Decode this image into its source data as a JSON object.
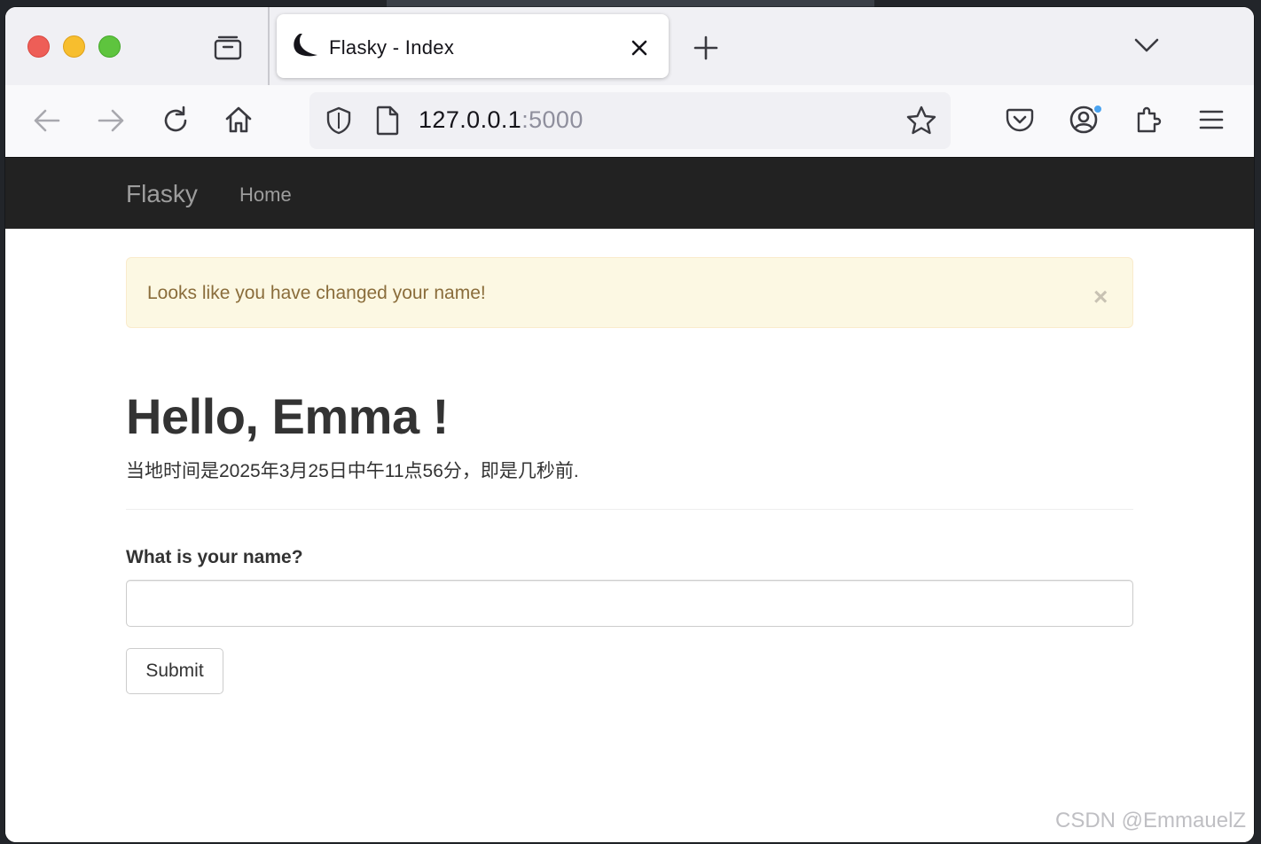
{
  "browser": {
    "tab_title": "Flasky - Index",
    "url_host": "127.0.0.1",
    "url_port": ":5000"
  },
  "navbar": {
    "brand": "Flasky",
    "links": [
      {
        "label": "Home"
      }
    ]
  },
  "alert": {
    "message": "Looks like you have changed your name!",
    "close_label": "×"
  },
  "main": {
    "greeting": "Hello, Emma !",
    "timestamp_text": "当地时间是2025年3月25日中午11点56分，即是几秒前."
  },
  "form": {
    "name_label": "What is your name?",
    "name_value": "",
    "submit_label": "Submit"
  },
  "watermark": "CSDN @EmmauelZ",
  "colors": {
    "navbar_bg": "#222222",
    "alert_bg": "#fcf8e3",
    "alert_text": "#8a6d3b",
    "profile_badge": "#4aa3f0"
  },
  "icons": [
    "tab-overview-icon",
    "flask-favicon-icon",
    "close-icon",
    "plus-icon",
    "chevron-down-icon",
    "back-arrow-icon",
    "forward-arrow-icon",
    "reload-icon",
    "home-icon",
    "shield-icon",
    "page-icon",
    "star-icon",
    "pocket-icon",
    "account-icon",
    "extensions-icon",
    "menu-icon"
  ]
}
